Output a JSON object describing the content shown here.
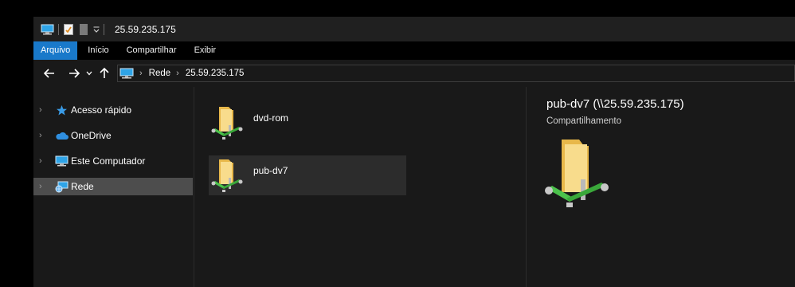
{
  "window": {
    "title": "25.59.235.175"
  },
  "ribbon": {
    "tabs": [
      {
        "label": "Arquivo",
        "active": true
      },
      {
        "label": "Início"
      },
      {
        "label": "Compartilhar"
      },
      {
        "label": "Exibir"
      }
    ]
  },
  "address": {
    "crumbs": [
      "Rede",
      "25.59.235.175"
    ]
  },
  "sidebar": {
    "items": [
      {
        "label": "Acesso rápido",
        "icon": "star-icon"
      },
      {
        "label": "OneDrive",
        "icon": "cloud-icon"
      },
      {
        "label": "Este Computador",
        "icon": "computer-icon"
      },
      {
        "label": "Rede",
        "icon": "network-icon",
        "selected": true
      }
    ]
  },
  "content": {
    "items": [
      {
        "name": "dvd-rom",
        "icon": "network-share-folder-icon"
      },
      {
        "name": "pub-dv7",
        "icon": "network-share-folder-icon",
        "hovered": true
      }
    ]
  },
  "details": {
    "title": "pub-dv7 (\\\\25.59.235.175)",
    "subtitle": "Compartilhamento"
  },
  "colors": {
    "accent": "#1979ca",
    "folder": "#f3d27a",
    "network_pipe": "#4cc24c"
  }
}
